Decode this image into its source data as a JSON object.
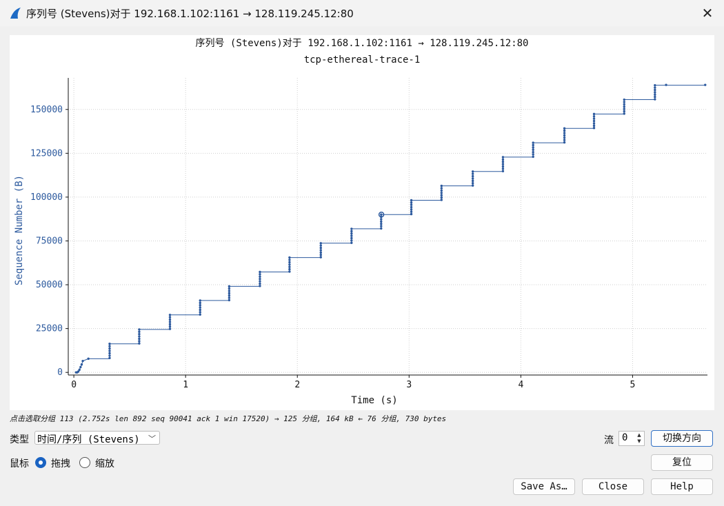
{
  "window": {
    "title": "序列号 (Stevens)对于 192.168.1.102:1161 → 128.119.245.12:80",
    "close_glyph": "✕"
  },
  "chart_data": {
    "type": "scatter",
    "title": "序列号 (Stevens)对于 192.168.1.102:1161 → 128.119.245.12:80",
    "subtitle": "tcp-ethereal-trace-1",
    "xlabel": "Time (s)",
    "ylabel": "Sequence Number (B)",
    "xlim": [
      -0.05,
      5.67
    ],
    "ylim": [
      -1500,
      168000
    ],
    "xticks": [
      0,
      1,
      2,
      3,
      4,
      5
    ],
    "yticks": [
      0,
      25000,
      50000,
      75000,
      100000,
      125000,
      150000
    ],
    "grid": true,
    "color": "#2d5a9e",
    "startup": [
      [
        0.02,
        0
      ],
      [
        0.03,
        0
      ],
      [
        0.04,
        500
      ],
      [
        0.05,
        1500
      ],
      [
        0.06,
        3000
      ],
      [
        0.07,
        4500
      ],
      [
        0.08,
        6500
      ],
      [
        0.13,
        7800
      ]
    ],
    "bursts": [
      {
        "t": 0.32,
        "from": 8200,
        "to": 16300
      },
      {
        "t": 0.585,
        "from": 16500,
        "to": 24500
      },
      {
        "t": 0.86,
        "from": 24800,
        "to": 32800
      },
      {
        "t": 1.13,
        "from": 33000,
        "to": 41000
      },
      {
        "t": 1.39,
        "from": 41200,
        "to": 49100
      },
      {
        "t": 1.665,
        "from": 49300,
        "to": 57300
      },
      {
        "t": 1.93,
        "from": 57500,
        "to": 65500
      },
      {
        "t": 2.21,
        "from": 65700,
        "to": 73700
      },
      {
        "t": 2.485,
        "from": 73900,
        "to": 81900
      },
      {
        "t": 2.75,
        "from": 82100,
        "to": 90041
      },
      {
        "t": 3.02,
        "from": 90300,
        "to": 98200
      },
      {
        "t": 3.29,
        "from": 98400,
        "to": 106400
      },
      {
        "t": 3.57,
        "from": 106600,
        "to": 114600
      },
      {
        "t": 3.84,
        "from": 114800,
        "to": 122800
      },
      {
        "t": 4.11,
        "from": 123000,
        "to": 131000
      },
      {
        "t": 4.39,
        "from": 131200,
        "to": 139200
      },
      {
        "t": 4.655,
        "from": 139400,
        "to": 147400
      },
      {
        "t": 4.925,
        "from": 147600,
        "to": 155600
      },
      {
        "t": 5.2,
        "from": 155800,
        "to": 163800
      }
    ],
    "tail": [
      [
        5.3,
        164000
      ],
      [
        5.65,
        164000
      ]
    ],
    "selected": {
      "t": 2.752,
      "seq": 90041
    }
  },
  "status": {
    "text": "点击选取分组 113 (2.752s len 892 seq 90041 ack 1 win 17520) → 125 分组, 164 kB ← 76 分组, 730 bytes"
  },
  "controls": {
    "type_label": "类型",
    "type_value": "时间/序列 (Stevens)",
    "mouse_label": "鼠标",
    "drag_label": "拖拽",
    "zoom_label": "缩放",
    "drag_selected": true,
    "stream_label": "流",
    "stream_value": "0",
    "switch_direction": "切换方向",
    "reset": "复位",
    "save_as": "Save As…",
    "close": "Close",
    "help": "Help"
  }
}
